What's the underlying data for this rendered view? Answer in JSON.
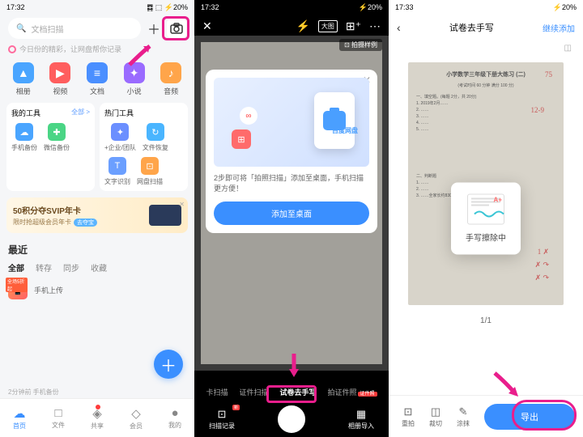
{
  "s1": {
    "status_time": "17:32",
    "status_right": "20%",
    "search_placeholder": "文档扫描",
    "banner": "今日份的精彩，让网盘帮你记录",
    "cats": [
      {
        "label": "相册",
        "color": "#4aa5ff",
        "glyph": "▲"
      },
      {
        "label": "视频",
        "color": "#ff5e5e",
        "glyph": "▶"
      },
      {
        "label": "文档",
        "color": "#4a8fff",
        "glyph": "≡"
      },
      {
        "label": "小说",
        "color": "#9a6bff",
        "glyph": "✦"
      },
      {
        "label": "音频",
        "color": "#ffa54a",
        "glyph": "♪"
      }
    ],
    "card1_title": "我的工具",
    "card1_link": "全部 >",
    "tools1": [
      {
        "label": "手机备份",
        "color": "#4aa5ff",
        "g": "☁"
      },
      {
        "label": "微信备份",
        "color": "#4ad585",
        "g": "✚"
      }
    ],
    "card2_title": "热门工具",
    "tools2": [
      {
        "label": "+企业/团队",
        "color": "#6b8fff",
        "g": "✦"
      },
      {
        "label": "文件恢复",
        "color": "#4ab5ff",
        "g": "↻"
      }
    ],
    "tools3": [
      {
        "label": "文字识别",
        "color": "#6b9fff",
        "g": "T"
      },
      {
        "label": "网盘扫描",
        "color": "#ffa54a",
        "g": "⊡"
      }
    ],
    "svip_t1": "50积分夺SVIP年卡",
    "svip_t2": "限时抢超级会员年卡",
    "svip_chip": "去夺宝",
    "recent": "最近",
    "tabs": [
      "全部",
      "转存",
      "同步",
      "收藏"
    ],
    "item1_badge": "全场5折起",
    "item1_label": "手机上传",
    "time_txt": "2分钟前  手机备份",
    "nav": [
      {
        "l": "首页",
        "g": "☁"
      },
      {
        "l": "文件",
        "g": "□"
      },
      {
        "l": "共享",
        "g": "◈"
      },
      {
        "l": "会员",
        "g": "◇"
      },
      {
        "l": "我的",
        "g": "●"
      }
    ]
  },
  "s2": {
    "status_time": "17:32",
    "status_right": "20%",
    "sample": "⊡ 拍摄样例",
    "modal_txt": "2步即可将「拍照扫描」添加至桌面，手机扫描更方便！",
    "modal_btn": "添加至桌面",
    "bdp_label": "百度网盘",
    "modes": [
      "卡扫描",
      "证件扫描",
      "试卷去手写",
      "拍证件照"
    ],
    "mode_active": 2,
    "mode_tag": "证件照",
    "bot_left": "扫描记录",
    "bot_right": "相册导入",
    "bot_new": "新"
  },
  "s3": {
    "status_time": "17:33",
    "status_right": "20%",
    "title": "试卷去手写",
    "add": "继续添加",
    "paper_title": "小学数学三年级下册大练习 (二)",
    "paper_sub": "(考试时间 60 分钟  满分 100 分)",
    "popup": "手写擦除中",
    "pager": "1/1",
    "acts": [
      {
        "l": "重拍",
        "g": "⊡"
      },
      {
        "l": "裁切",
        "g": "◫"
      },
      {
        "l": "涂抹",
        "g": "✎"
      }
    ],
    "export": "导出"
  }
}
